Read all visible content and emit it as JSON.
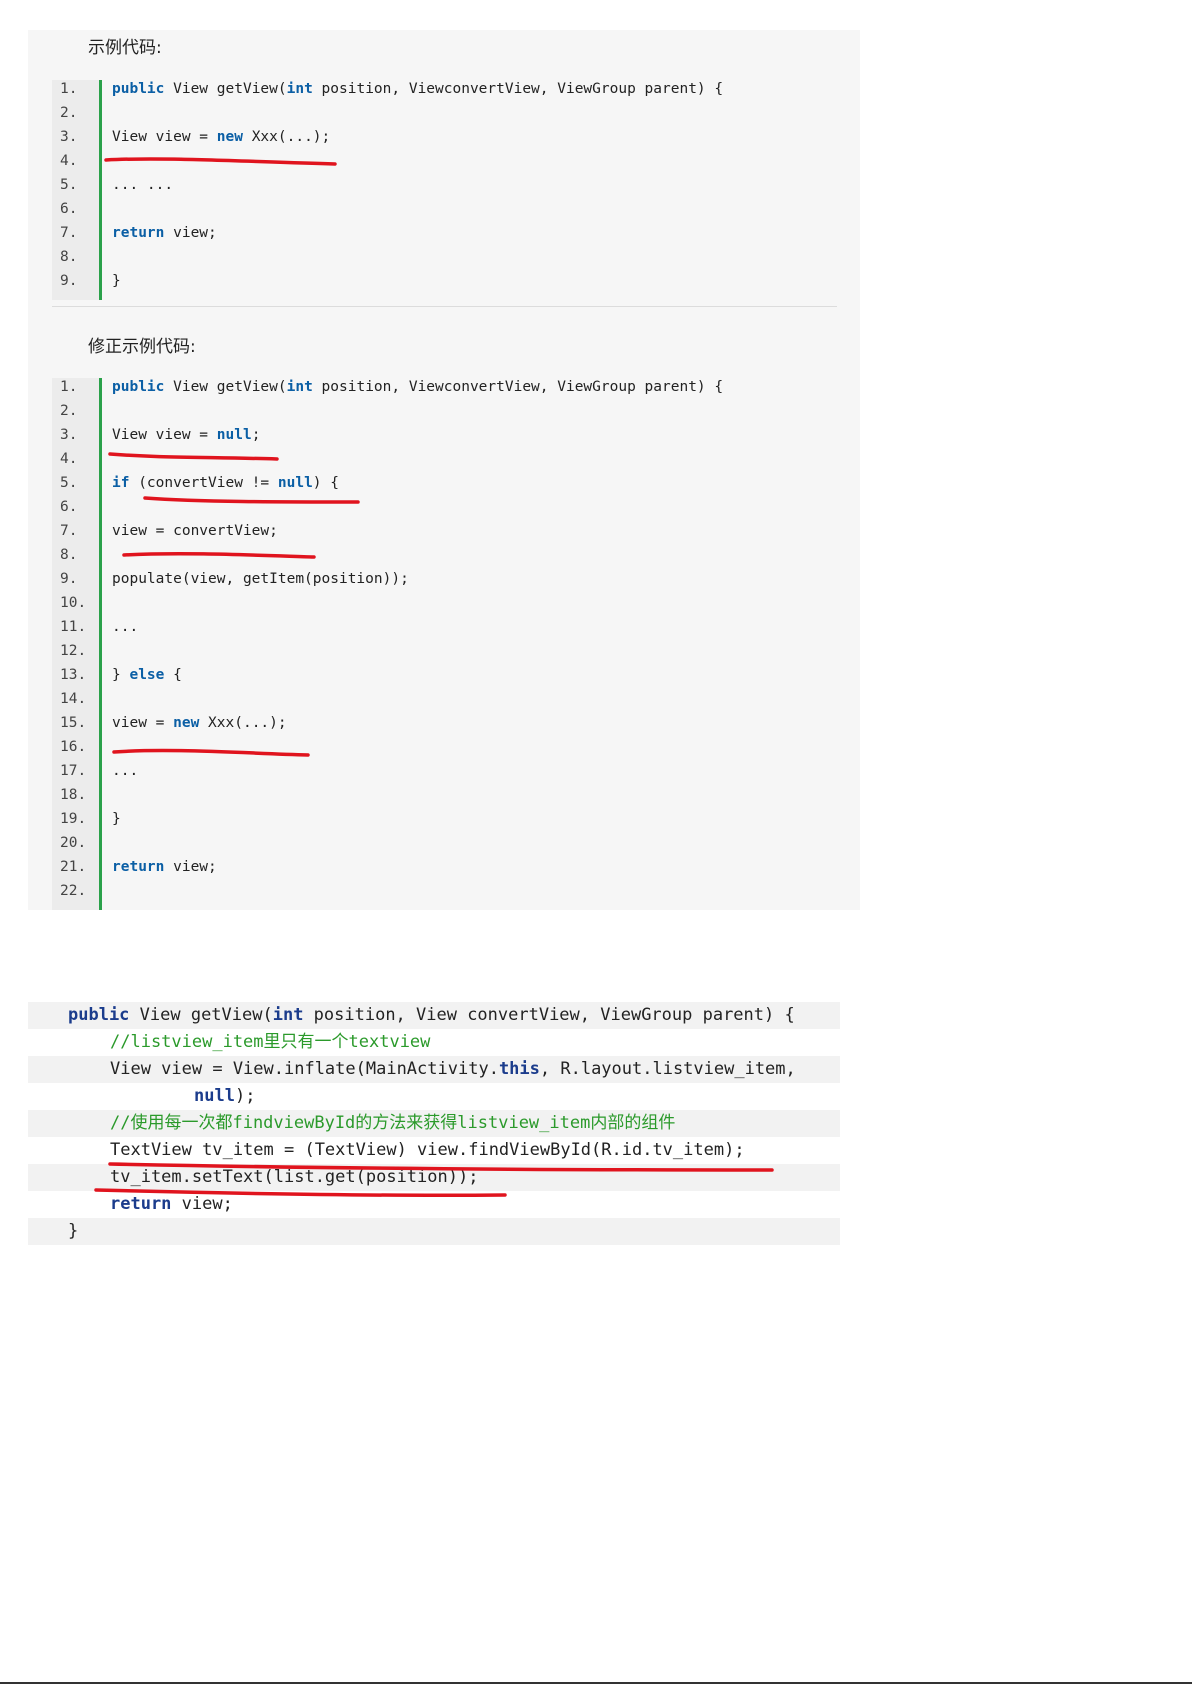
{
  "section1": {
    "caption": "示例代码:",
    "lines": [
      {
        "n": "1.",
        "parts": [
          {
            "t": "public",
            "k": 1
          },
          {
            "t": " View getView("
          },
          {
            "t": "int",
            "k": 1
          },
          {
            "t": " position, ViewconvertView, ViewGroup parent) {"
          }
        ]
      },
      {
        "n": "2.",
        "parts": []
      },
      {
        "n": "3.",
        "parts": [
          {
            "t": "View view = "
          },
          {
            "t": "new",
            "k": 1
          },
          {
            "t": " Xxx(...);"
          }
        ]
      },
      {
        "n": "4.",
        "parts": []
      },
      {
        "n": "5.",
        "parts": [
          {
            "t": "... ..."
          }
        ]
      },
      {
        "n": "6.",
        "parts": []
      },
      {
        "n": "7.",
        "parts": [
          {
            "t": "return",
            "k": 1
          },
          {
            "t": " view;"
          }
        ]
      },
      {
        "n": "8.",
        "parts": []
      },
      {
        "n": "9.",
        "parts": [
          {
            "t": "}"
          }
        ]
      }
    ]
  },
  "section2": {
    "caption": "修正示例代码:",
    "lines": [
      {
        "n": "1.",
        "parts": [
          {
            "t": "public",
            "k": 1
          },
          {
            "t": " View getView("
          },
          {
            "t": "int",
            "k": 1
          },
          {
            "t": " position, ViewconvertView, ViewGroup parent) {"
          }
        ]
      },
      {
        "n": "2.",
        "parts": []
      },
      {
        "n": "3.",
        "parts": [
          {
            "t": "View view = "
          },
          {
            "t": "null",
            "k": 1
          },
          {
            "t": ";"
          }
        ]
      },
      {
        "n": "4.",
        "parts": []
      },
      {
        "n": "5.",
        "parts": [
          {
            "t": "if",
            "k": 1
          },
          {
            "t": " (convertView != "
          },
          {
            "t": "null",
            "k": 1
          },
          {
            "t": ") {"
          }
        ]
      },
      {
        "n": "6.",
        "parts": []
      },
      {
        "n": "7.",
        "parts": [
          {
            "t": "view = convertView;"
          }
        ]
      },
      {
        "n": "8.",
        "parts": []
      },
      {
        "n": "9.",
        "parts": [
          {
            "t": "populate(view, getItem(position));"
          }
        ]
      },
      {
        "n": "10.",
        "parts": []
      },
      {
        "n": "11.",
        "parts": [
          {
            "t": "..."
          }
        ]
      },
      {
        "n": "12.",
        "parts": []
      },
      {
        "n": "13.",
        "parts": [
          {
            "t": "} "
          },
          {
            "t": "else",
            "k": 1
          },
          {
            "t": " {"
          }
        ]
      },
      {
        "n": "14.",
        "parts": []
      },
      {
        "n": "15.",
        "parts": [
          {
            "t": "view = "
          },
          {
            "t": "new",
            "k": 1
          },
          {
            "t": " Xxx(...);"
          }
        ]
      },
      {
        "n": "16.",
        "parts": []
      },
      {
        "n": "17.",
        "parts": [
          {
            "t": "..."
          }
        ]
      },
      {
        "n": "18.",
        "parts": []
      },
      {
        "n": "19.",
        "parts": [
          {
            "t": "}"
          }
        ]
      },
      {
        "n": "20.",
        "parts": []
      },
      {
        "n": "21.",
        "parts": [
          {
            "t": "return",
            "k": 1
          },
          {
            "t": " view;"
          }
        ]
      },
      {
        "n": "22.",
        "parts": []
      }
    ]
  },
  "section3": {
    "lines": [
      {
        "indent": 1,
        "shade": 1,
        "parts": [
          {
            "t": "public",
            "k": 1
          },
          {
            "t": " View getView("
          },
          {
            "t": "int",
            "k": 1
          },
          {
            "t": " position, View convertView, ViewGroup parent) {"
          }
        ]
      },
      {
        "indent": 2,
        "shade": 0,
        "parts": [
          {
            "t": "//listview_item里只有一个textview",
            "c": 1
          }
        ]
      },
      {
        "indent": 2,
        "shade": 1,
        "parts": [
          {
            "t": "View view = View.inflate(MainActivity."
          },
          {
            "t": "this",
            "k": 1
          },
          {
            "t": ", R.layout.listview_item,"
          }
        ]
      },
      {
        "indent": 3,
        "shade": 0,
        "parts": [
          {
            "t": "null",
            "k": 1
          },
          {
            "t": ");"
          }
        ]
      },
      {
        "indent": 2,
        "shade": 1,
        "parts": [
          {
            "t": "//使用每一次都findviewById的方法来获得listview_item内部的组件",
            "c": 1
          }
        ]
      },
      {
        "indent": 2,
        "shade": 0,
        "parts": [
          {
            "t": "TextView tv_item = (TextView) view.findViewById(R.id.tv_item);"
          }
        ]
      },
      {
        "indent": 2,
        "shade": 1,
        "parts": [
          {
            "t": "tv_item.setText(list.get(position));"
          }
        ]
      },
      {
        "indent": 2,
        "shade": 0,
        "parts": [
          {
            "t": "return",
            "k": 1
          },
          {
            "t": " view;"
          }
        ]
      },
      {
        "indent": 1,
        "shade": 1,
        "parts": [
          {
            "t": "}"
          }
        ]
      }
    ]
  },
  "colors": {
    "keyword": "#0b5fa5",
    "ide_keyword": "#1b3c8c",
    "comment": "#2b9a2b",
    "gutter_bar": "#2aa14a",
    "underline": "#e0141e"
  }
}
